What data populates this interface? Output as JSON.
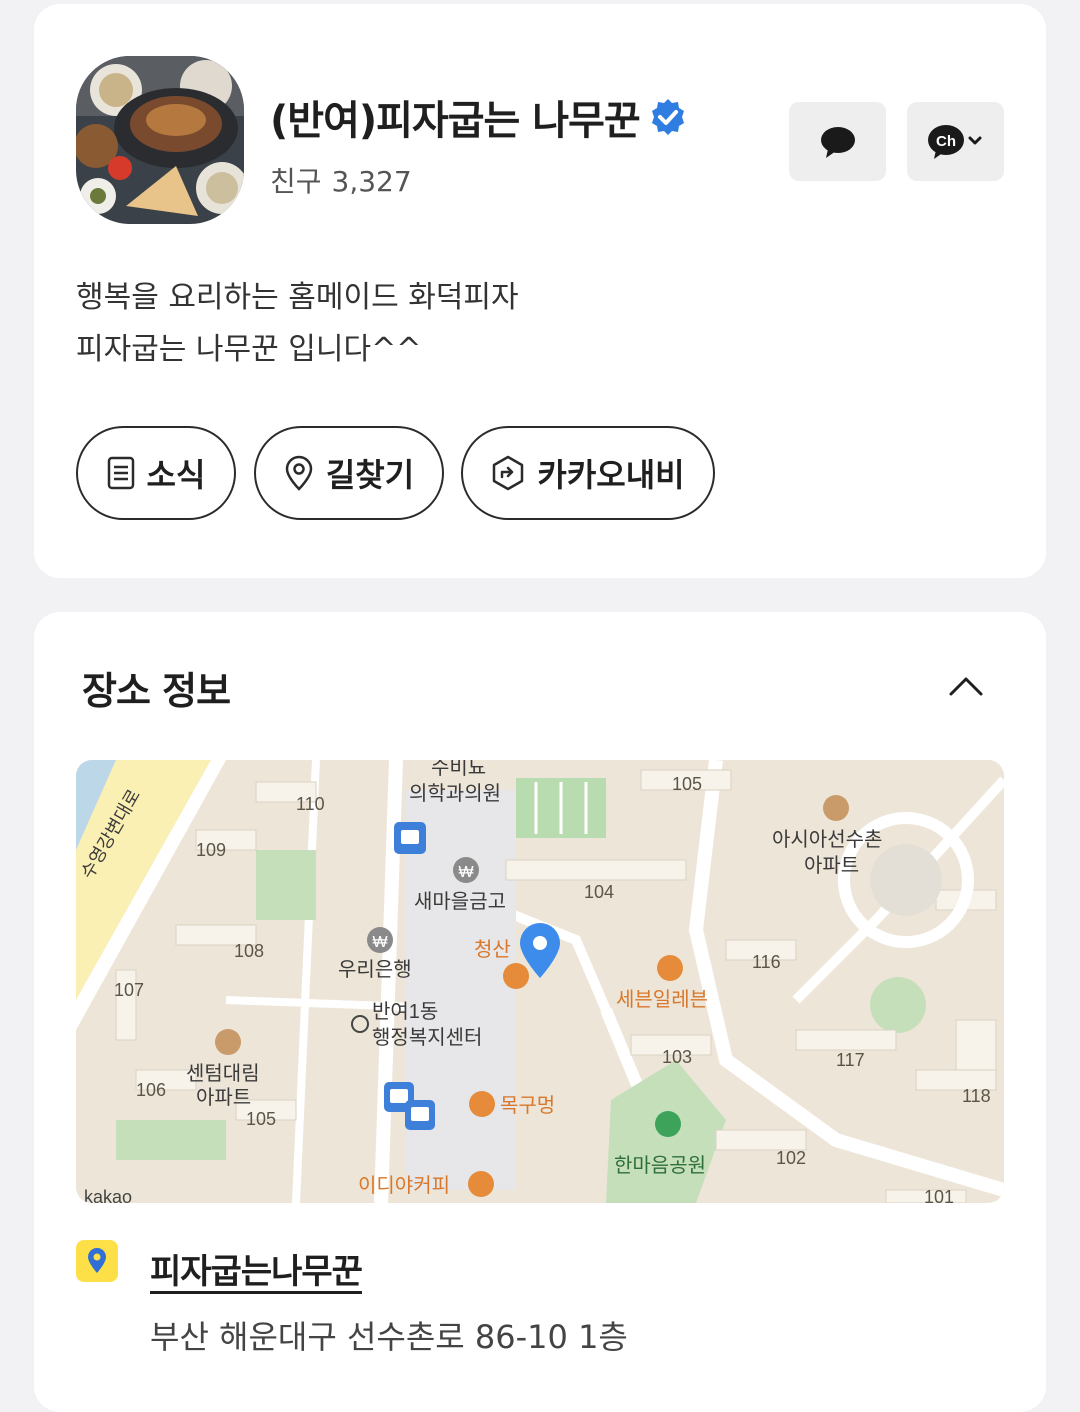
{
  "profile": {
    "channel_name": "(반여)피자굽는 나무꾼",
    "friends_label": "친구",
    "friends_count": "3,327",
    "intro_lines": [
      "행복을 요리하는 홈메이드 화덕피자",
      "피자굽는 나무꾼 입니다^^"
    ],
    "chat_icon": "speech-bubble-icon",
    "channel_menu_icon": "ch-icon",
    "channel_menu_badge": "Ch"
  },
  "actions": [
    {
      "label": "소식",
      "icon": "document-icon"
    },
    {
      "label": "길찾기",
      "icon": "location-pin-icon"
    },
    {
      "label": "카카오내비",
      "icon": "navigation-icon"
    }
  ],
  "place": {
    "section_title": "장소 정보",
    "name": "피자굽는나무꾼",
    "address": "부산 해운대구 선수촌로 86-10 1층"
  },
  "map": {
    "labels": {
      "road": "수영강변대로",
      "clinic_top": "수비뇨",
      "clinic": "의학과의원",
      "bank1": "새마을금고",
      "bank2": "우리은행",
      "store_partial": "청산",
      "center1": "반여1동",
      "center2": "행정복지센터",
      "apt1": "센텀대림",
      "apt1b": "아파트",
      "apt2": "아시아선수촌",
      "apt2b": "아파트",
      "store": "세븐일레븐",
      "restaurant": "목구멍",
      "park": "한마음공원",
      "cafe": "이디야커피",
      "attribution": "kakao",
      "won": "₩"
    },
    "building_numbers": [
      "110",
      "109",
      "108",
      "107",
      "106",
      "105",
      "105",
      "104",
      "116",
      "103",
      "117",
      "118",
      "102",
      "101"
    ]
  }
}
